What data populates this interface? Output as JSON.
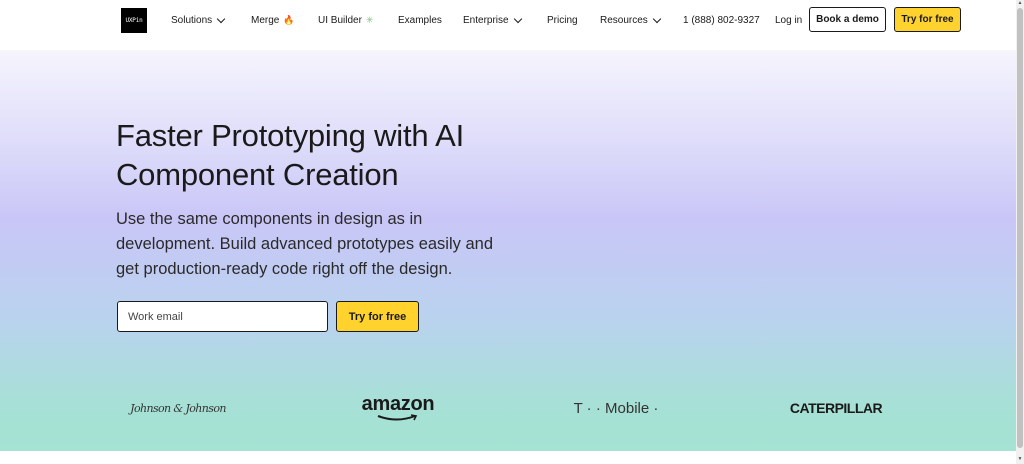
{
  "nav": {
    "logo": "UXPin",
    "items": [
      {
        "label": "Solutions",
        "has_chevron": true,
        "icon": ""
      },
      {
        "label": "Merge",
        "has_chevron": false,
        "icon": "🔥"
      },
      {
        "label": "UI Builder",
        "has_chevron": false,
        "icon": "✳"
      },
      {
        "label": "Examples",
        "has_chevron": false,
        "icon": ""
      },
      {
        "label": "Enterprise",
        "has_chevron": true,
        "icon": ""
      },
      {
        "label": "Pricing",
        "has_chevron": false,
        "icon": ""
      },
      {
        "label": "Resources",
        "has_chevron": true,
        "icon": ""
      }
    ],
    "phone": "1 (888) 802-9327",
    "login": "Log in",
    "demo_button": "Book a demo",
    "try_button": "Try for free"
  },
  "hero": {
    "title": "Faster Prototyping with AI Component Creation",
    "subtitle": "Use the same components in design as in development. Build advanced prototypes easily and get production-ready code right off the design.",
    "email_placeholder": "Work email",
    "cta": "Try for free"
  },
  "customers": [
    "Johnson & Johnson",
    "amazon",
    "T · · Mobile ·",
    "CATERPILLAR"
  ],
  "colors": {
    "accent_yellow": "#ffd22e",
    "text": "#1a1a1a",
    "gradient_top": "#f6f5fd",
    "gradient_mid": "#c9c6f7",
    "gradient_bottom": "#a5e3d3"
  },
  "icons": [
    "chevron-down-icon",
    "fire-icon",
    "sparkle-icon",
    "amazon-smile-icon"
  ]
}
